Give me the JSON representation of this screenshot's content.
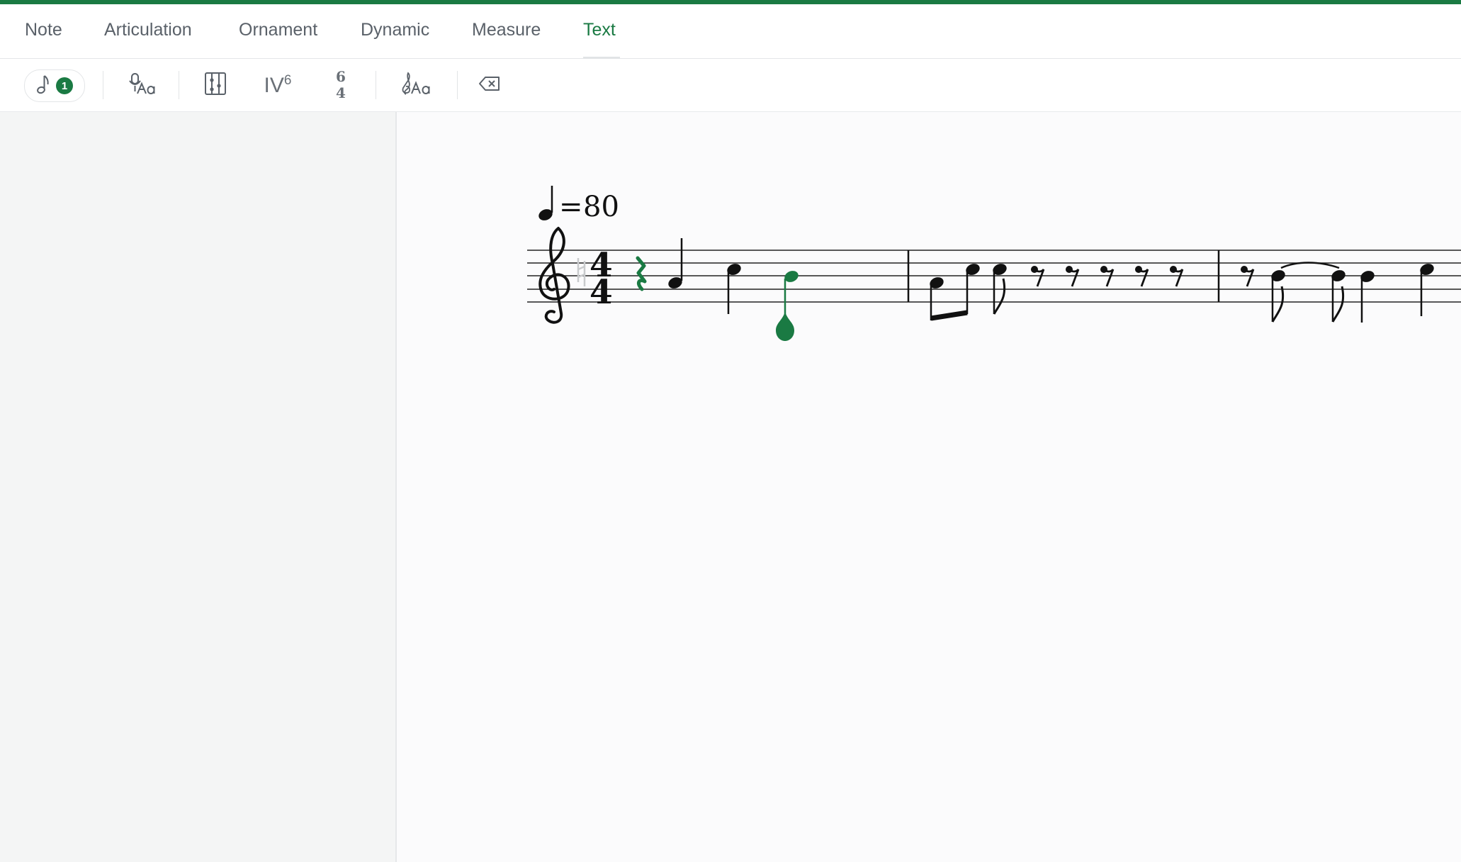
{
  "tabs": [
    {
      "label": "Note"
    },
    {
      "label": "Articulation"
    },
    {
      "label": "Ornament"
    },
    {
      "label": "Dynamic"
    },
    {
      "label": "Measure"
    },
    {
      "label": "Text"
    }
  ],
  "active_tab": "Text",
  "toolbar": {
    "voice_badge": "1",
    "chord_symbol": {
      "base": "IV",
      "sup": "6"
    },
    "figured_bass": {
      "top": "6",
      "bottom": "4"
    }
  },
  "score": {
    "tempo_value": "80",
    "tempo_equals": "=",
    "time_signature": {
      "top": "4",
      "bottom": "4"
    }
  },
  "colors": {
    "accent": "#1a7a43",
    "inactive_text": "#5a6169"
  }
}
